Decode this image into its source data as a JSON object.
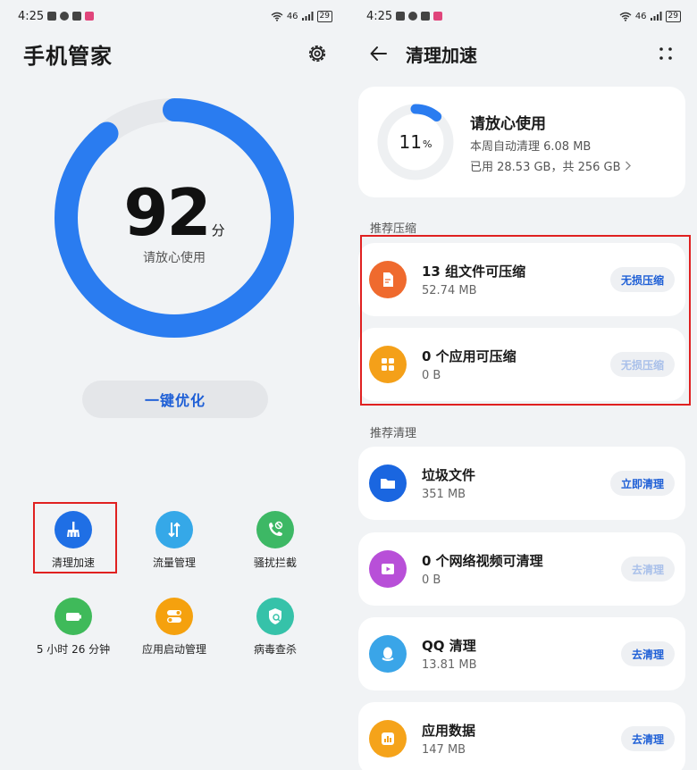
{
  "status": {
    "time": "4:25",
    "network": "46",
    "battery": "29"
  },
  "left": {
    "title": "手机管家",
    "score": "92",
    "score_unit": "分",
    "score_desc": "请放心使用",
    "score_fraction": 0.92,
    "optimize_label": "一键优化",
    "tools": [
      {
        "label": "清理加速",
        "icon": "broom-icon",
        "color": "#1f6fe5"
      },
      {
        "label": "流量管理",
        "icon": "data-flow-icon",
        "color": "#35a8e8"
      },
      {
        "label": "骚扰拦截",
        "icon": "call-block-icon",
        "color": "#3db865"
      },
      {
        "label": "5 小时 26 分钟",
        "icon": "battery-icon",
        "color": "#3fba5a"
      },
      {
        "label": "应用启动管理",
        "icon": "toggle-icon",
        "color": "#f5a10e"
      },
      {
        "label": "病毒查杀",
        "icon": "shield-scan-icon",
        "color": "#36c2a9"
      }
    ]
  },
  "right": {
    "title": "清理加速",
    "summary": {
      "percent": "11",
      "percent_unit": "%",
      "usage_fraction": 0.11,
      "title": "请放心使用",
      "weekly": "本周自动清理 6.08 MB",
      "storage": "已用 28.53 GB，共 256 GB"
    },
    "compress_section": "推荐压缩",
    "compress_items": [
      {
        "title": "13 组文件可压缩",
        "sub": "52.74 MB",
        "action": "无损压缩",
        "icon": "file-compress-icon",
        "color": "#ef6a2e",
        "enabled": true
      },
      {
        "title": "0 个应用可压缩",
        "sub": "0 B",
        "action": "无损压缩",
        "icon": "apps-grid-icon",
        "color": "#f4a019",
        "enabled": false
      }
    ],
    "clean_section": "推荐清理",
    "clean_items": [
      {
        "title": "垃圾文件",
        "sub": "351 MB",
        "action": "立即清理",
        "icon": "folder-icon",
        "color": "#1a66e0",
        "enabled": true
      },
      {
        "title": "0 个网络视频可清理",
        "sub": "0 B",
        "action": "去清理",
        "icon": "video-icon",
        "color": "#b84fd8",
        "enabled": false
      },
      {
        "title": "QQ 清理",
        "sub": "13.81 MB",
        "action": "去清理",
        "icon": "qq-icon",
        "color": "#3aa5e8",
        "enabled": true
      },
      {
        "title": "应用数据",
        "sub": "147 MB",
        "action": "去清理",
        "icon": "app-data-icon",
        "color": "#f5a31a",
        "enabled": true
      }
    ]
  }
}
